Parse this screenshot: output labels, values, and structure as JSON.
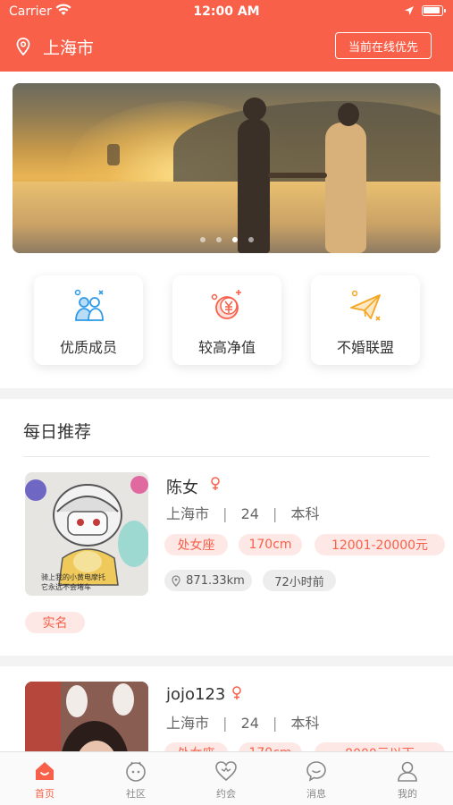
{
  "status_bar": {
    "carrier": "Carrier",
    "time": "12:00 AM"
  },
  "header": {
    "city": "上海市",
    "online_button": "当前在线优先"
  },
  "banner": {
    "page_count": 4,
    "active_page": 3
  },
  "quick_entries": [
    {
      "label": "优质成员",
      "icon": "quality-members-icon"
    },
    {
      "label": "较高净值",
      "icon": "high-net-worth-icon"
    },
    {
      "label": "不婚联盟",
      "icon": "no-marriage-alliance-icon"
    }
  ],
  "daily": {
    "title": "每日推荐",
    "members": [
      {
        "name": "陈女",
        "gender": "female",
        "city": "上海市",
        "age": "24",
        "education": "本科",
        "sep": "|",
        "tags": [
          "处女座",
          "170cm",
          "12001-20000元"
        ],
        "distance": "871.33km",
        "last_active": "72小时前",
        "extra_tag": "实名",
        "avatar_caption": "骑上我的小黄电摩托，它永远不会堵车"
      },
      {
        "name": "jojo123",
        "gender": "female",
        "city": "上海市",
        "age": "24",
        "education": "本科",
        "sep": "|",
        "tags": [
          "处女座",
          "170cm",
          "8000元以下"
        ]
      }
    ]
  },
  "tabbar": {
    "items": [
      {
        "label": "首页",
        "icon": "home-icon",
        "active": true
      },
      {
        "label": "社区",
        "icon": "community-icon",
        "active": false
      },
      {
        "label": "约会",
        "icon": "date-icon",
        "active": false
      },
      {
        "label": "消息",
        "icon": "message-icon",
        "active": false
      },
      {
        "label": "我的",
        "icon": "profile-icon",
        "active": false
      }
    ]
  },
  "colors": {
    "primary": "#f8604a",
    "tag_bg": "#fde8e5",
    "gray_tag_bg": "#ededed",
    "background": "#ffffff"
  }
}
